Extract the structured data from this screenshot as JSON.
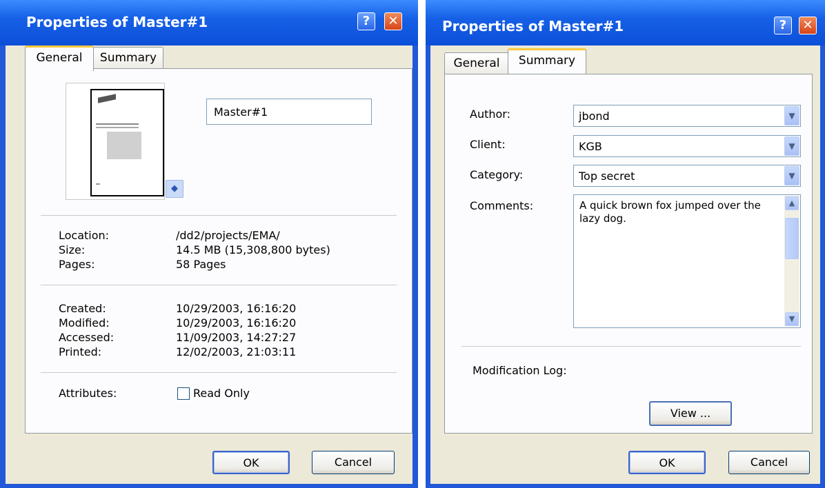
{
  "left": {
    "title": "Properties of Master#1",
    "help_glyph": "?",
    "close_glyph": "✕",
    "tabs": [
      "General",
      "Summary"
    ],
    "name_value": "Master#1",
    "info": [
      {
        "label": "Location:",
        "value": "/dd2/projects/EMA/"
      },
      {
        "label": "Size:",
        "value": "14.5 MB (15,308,800 bytes)"
      },
      {
        "label": "Pages:",
        "value": "58 Pages"
      }
    ],
    "dates": [
      {
        "label": "Created:",
        "value": "10/29/2003, 16:16:20"
      },
      {
        "label": "Modified:",
        "value": "10/29/2003, 16:16:20"
      },
      {
        "label": "Accessed:",
        "value": "11/09/2003, 14:27:27"
      },
      {
        "label": "Printed:",
        "value": "12/02/2003, 21:03:11"
      }
    ],
    "attributes_label": "Attributes:",
    "read_only_label": "Read Only",
    "ok": "OK",
    "cancel": "Cancel"
  },
  "right": {
    "title": "Properties of Master#1",
    "help_glyph": "?",
    "close_glyph": "✕",
    "tabs": [
      "General",
      "Summary"
    ],
    "author_label": "Author:",
    "author_value": "jbond",
    "client_label": "Client:",
    "client_value": "KGB",
    "category_label": "Category:",
    "category_value": "Top secret",
    "comments_label": "Comments:",
    "comments_value": "A quick brown fox jumped over the lazy dog.",
    "modlog_label": "Modification Log:",
    "view_button": "View ...",
    "ok": "OK",
    "cancel": "Cancel"
  },
  "colors": {
    "title_blue": "#0c4fd8",
    "dialog_bg": "#ece9d8",
    "tab_accent": "#ffc73c",
    "close_red": "#d8441a"
  }
}
